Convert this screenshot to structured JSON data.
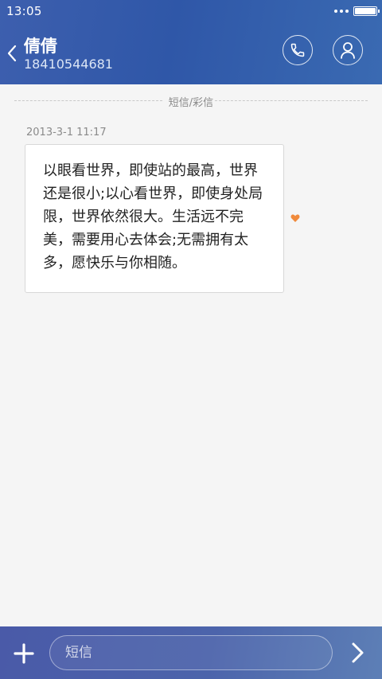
{
  "status_bar": {
    "time": "13:05"
  },
  "header": {
    "contact_name": "倩倩",
    "contact_number": "18410544681"
  },
  "conversation": {
    "divider_label": "短信/彩信",
    "messages": [
      {
        "timestamp": "2013-3-1 11:17",
        "text": "以眼看世界，即使站的最高，世界还是很小;以心看世界，即使身处局限，世界依然很大。生活远不完美，需要用心去体会;无需拥有太多，愿快乐与你相随。",
        "favorited": true
      }
    ]
  },
  "composer": {
    "placeholder": "短信"
  },
  "colors": {
    "header_gradient_start": "#3d5fae",
    "header_gradient_end": "#3a6ab2",
    "background": "#f5f5f5",
    "favorite_heart": "#f08a3c"
  },
  "icons": {
    "back": "chevron-left-icon",
    "call": "phone-icon",
    "profile": "person-icon",
    "favorite": "heart-icon",
    "add": "plus-icon",
    "send": "chevron-right-icon"
  }
}
